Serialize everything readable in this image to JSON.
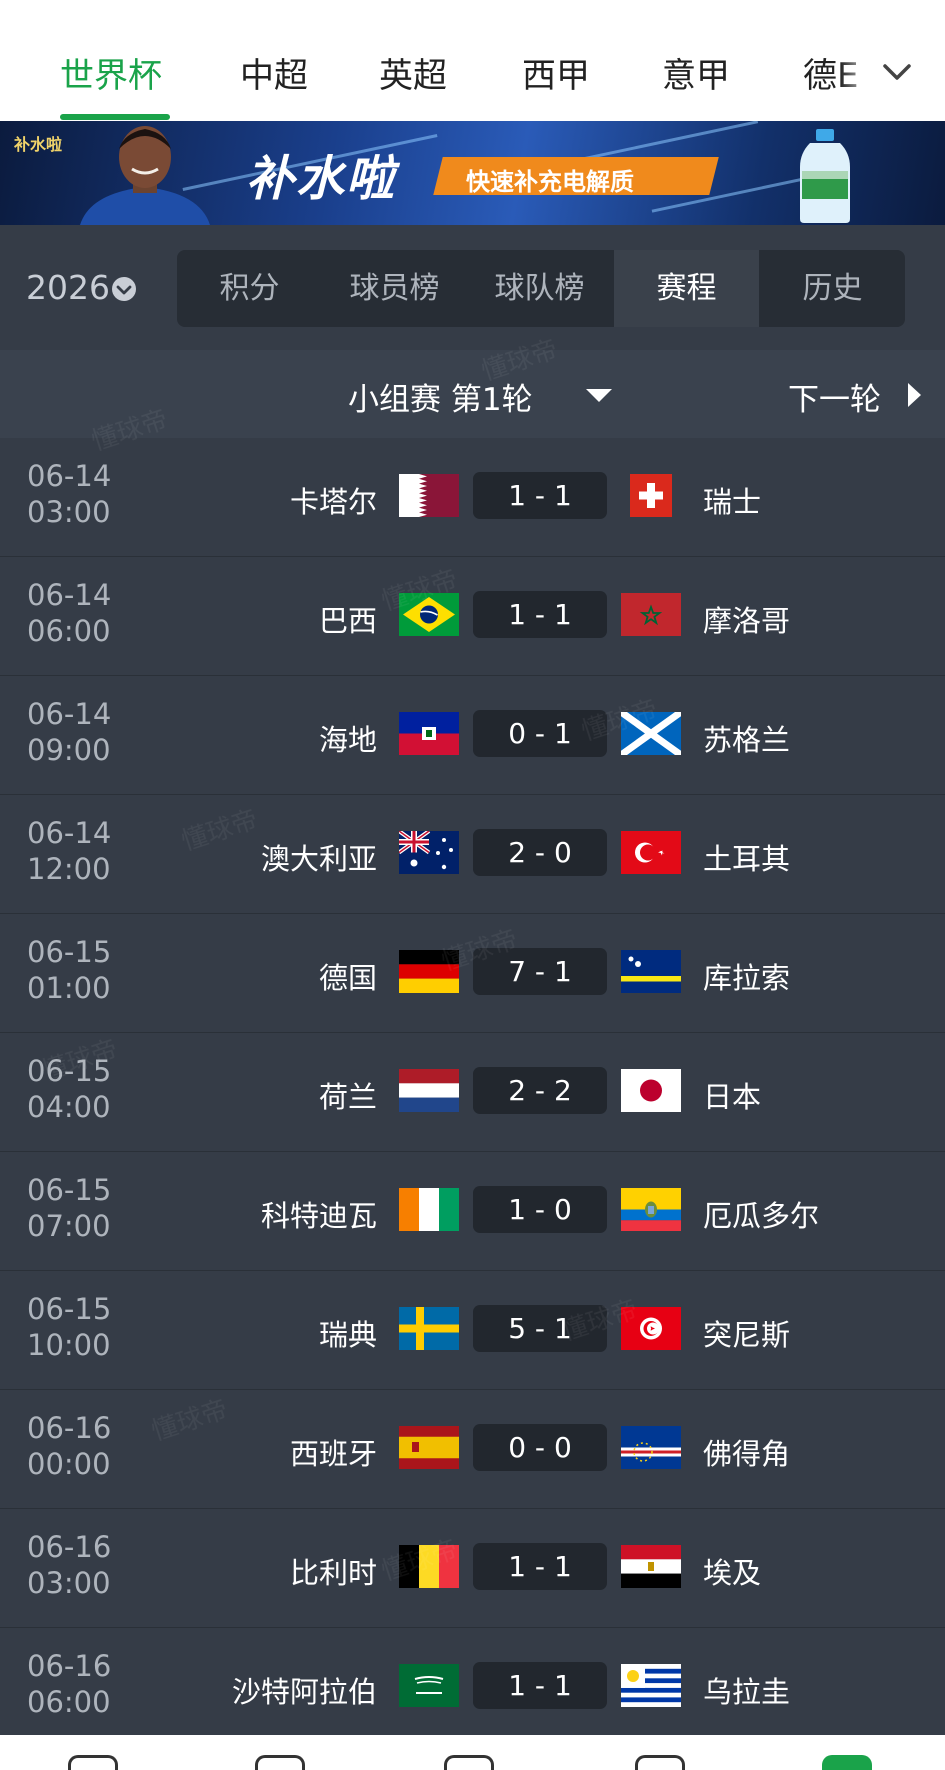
{
  "top_nav": {
    "tabs": [
      "世界杯",
      "中超",
      "英超",
      "西甲",
      "意甲",
      "德E"
    ],
    "active_index": 0,
    "accent_color": "#1aa34a",
    "more_icon": "chevron-down-icon"
  },
  "banner": {
    "brand_small": "补水啦",
    "title": "补水啦",
    "tagline": "快速补充电解质"
  },
  "season": {
    "year": "2026",
    "dropdown_icon": "chevron-down-circle-icon"
  },
  "sub_tabs": {
    "items": [
      "积分",
      "球员榜",
      "球队榜",
      "赛程",
      "历史"
    ],
    "active_index": 3
  },
  "round": {
    "label": "小组赛 第1轮",
    "next_label": "下一轮"
  },
  "matches": [
    {
      "date": "06-14",
      "time": "03:00",
      "home": "卡塔尔",
      "home_flag": "qatar-flag-icon",
      "score": "1 - 1",
      "away": "瑞士",
      "away_flag": "switzerland-flag-icon"
    },
    {
      "date": "06-14",
      "time": "06:00",
      "home": "巴西",
      "home_flag": "brazil-flag-icon",
      "score": "1 - 1",
      "away": "摩洛哥",
      "away_flag": "morocco-flag-icon"
    },
    {
      "date": "06-14",
      "time": "09:00",
      "home": "海地",
      "home_flag": "haiti-flag-icon",
      "score": "0 - 1",
      "away": "苏格兰",
      "away_flag": "scotland-flag-icon"
    },
    {
      "date": "06-14",
      "time": "12:00",
      "home": "澳大利亚",
      "home_flag": "australia-flag-icon",
      "score": "2 - 0",
      "away": "土耳其",
      "away_flag": "turkey-flag-icon"
    },
    {
      "date": "06-15",
      "time": "01:00",
      "home": "德国",
      "home_flag": "germany-flag-icon",
      "score": "7 - 1",
      "away": "库拉索",
      "away_flag": "curacao-flag-icon"
    },
    {
      "date": "06-15",
      "time": "04:00",
      "home": "荷兰",
      "home_flag": "netherlands-flag-icon",
      "score": "2 - 2",
      "away": "日本",
      "away_flag": "japan-flag-icon"
    },
    {
      "date": "06-15",
      "time": "07:00",
      "home": "科特迪瓦",
      "home_flag": "ivory-coast-flag-icon",
      "score": "1 - 0",
      "away": "厄瓜多尔",
      "away_flag": "ecuador-flag-icon"
    },
    {
      "date": "06-15",
      "time": "10:00",
      "home": "瑞典",
      "home_flag": "sweden-flag-icon",
      "score": "5 - 1",
      "away": "突尼斯",
      "away_flag": "tunisia-flag-icon"
    },
    {
      "date": "06-16",
      "time": "00:00",
      "home": "西班牙",
      "home_flag": "spain-flag-icon",
      "score": "0 - 0",
      "away": "佛得角",
      "away_flag": "cape-verde-flag-icon"
    },
    {
      "date": "06-16",
      "time": "03:00",
      "home": "比利时",
      "home_flag": "belgium-flag-icon",
      "score": "1 - 1",
      "away": "埃及",
      "away_flag": "egypt-flag-icon"
    },
    {
      "date": "06-16",
      "time": "06:00",
      "home": "沙特阿拉伯",
      "home_flag": "saudi-arabia-flag-icon",
      "score": "1 - 1",
      "away": "乌拉圭",
      "away_flag": "uruguay-flag-icon"
    }
  ],
  "watermark": "懂球帝"
}
